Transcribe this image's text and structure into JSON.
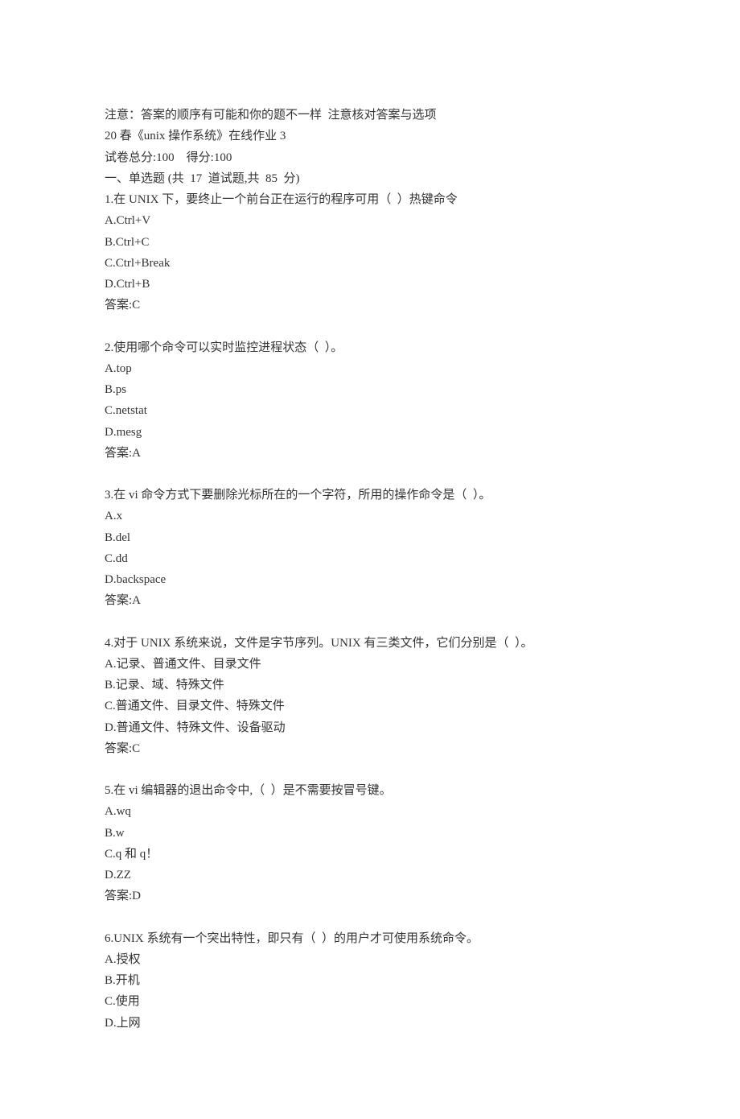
{
  "notice": "注意：答案的顺序有可能和你的题不一样  注意核对答案与选项",
  "title": "20 春《unix 操作系统》在线作业 3",
  "score_line": "试卷总分:100    得分:100",
  "section_header": "一、单选题 (共  17  道试题,共  85  分)",
  "questions": [
    {
      "stem": "1.在 UNIX 下，要终止一个前台正在运行的程序可用（  ）热键命令",
      "options": [
        "A.Ctrl+V",
        "B.Ctrl+C",
        "C.Ctrl+Break",
        "D.Ctrl+B"
      ],
      "answer": "答案:C"
    },
    {
      "stem": "2.使用哪个命令可以实时监控进程状态（  ）。",
      "options": [
        "A.top",
        "B.ps",
        "C.netstat",
        "D.mesg"
      ],
      "answer": "答案:A"
    },
    {
      "stem": "3.在 vi 命令方式下要删除光标所在的一个字符，所用的操作命令是（  ）。",
      "options": [
        "A.x",
        "B.del",
        "C.dd",
        "D.backspace"
      ],
      "answer": "答案:A"
    },
    {
      "stem": "4.对于 UNIX 系统来说，文件是字节序列。UNIX 有三类文件，它们分别是（  ）。",
      "options": [
        "A.记录、普通文件、目录文件",
        "B.记录、域、特殊文件",
        "C.普通文件、目录文件、特殊文件",
        "D.普通文件、特殊文件、设备驱动"
      ],
      "answer": "答案:C"
    },
    {
      "stem": "5.在 vi 编辑器的退出命令中,（  ）是不需要按冒号键。",
      "options": [
        "A.wq",
        "B.w",
        "C.q 和 q！",
        "D.ZZ"
      ],
      "answer": "答案:D"
    },
    {
      "stem": "6.UNIX 系统有一个突出特性，即只有（  ）的用户才可使用系统命令。",
      "options": [
        "A.授权",
        "B.开机",
        "C.使用",
        "D.上网"
      ],
      "answer": ""
    }
  ]
}
